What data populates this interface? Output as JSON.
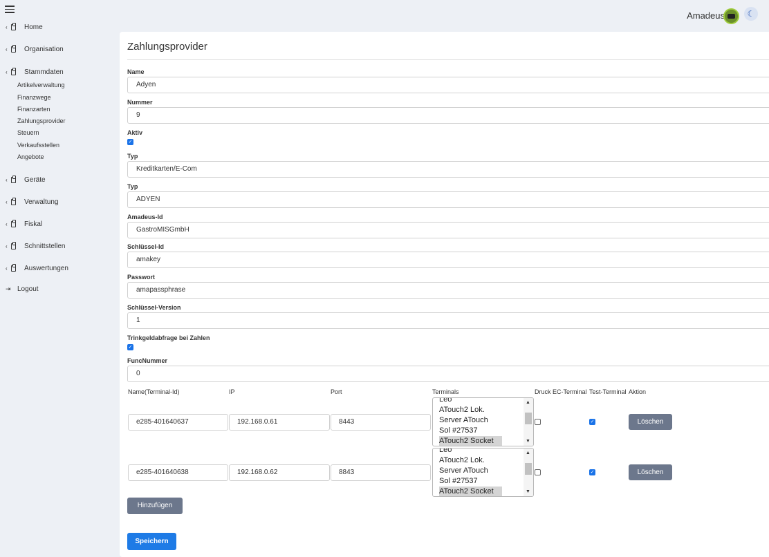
{
  "header": {
    "brand": "Amadeus",
    "brand_logo_icon": "amadeus-logo",
    "theme_icon": "moon-icon"
  },
  "sidebar": {
    "menu_icon": "hamburger-icon",
    "items": [
      {
        "label": "Home"
      },
      {
        "label": "Organisation"
      },
      {
        "label": "Stammdaten"
      },
      {
        "label": "Geräte"
      },
      {
        "label": "Verwaltung"
      },
      {
        "label": "Fiskal"
      },
      {
        "label": "Schnittstellen"
      },
      {
        "label": "Auswertungen"
      }
    ],
    "subitems": [
      {
        "label": "Artikelverwaltung"
      },
      {
        "label": "Finanzwege"
      },
      {
        "label": "Finanzarten"
      },
      {
        "label": "Zahlungsprovider"
      },
      {
        "label": "Steuern"
      },
      {
        "label": "Verkaufsstellen"
      },
      {
        "label": "Angebote"
      }
    ],
    "logout": "Logout"
  },
  "page": {
    "title": "Zahlungsprovider"
  },
  "form": {
    "name_label": "Name",
    "name_value": "Adyen",
    "nummer_label": "Nummer",
    "nummer_value": "9",
    "aktiv_label": "Aktiv",
    "aktiv_checked": true,
    "typ1_label": "Typ",
    "typ1_value": "Kreditkarten/E-Com",
    "typ2_label": "Typ",
    "typ2_value": "ADYEN",
    "amadeus_id_label": "Amadeus-Id",
    "amadeus_id_value": "GastroMISGmbH",
    "schluessel_id_label": "Schlüssel-Id",
    "schluessel_id_value": "amakey",
    "passwort_label": "Passwort",
    "passwort_value": "amapassphrase",
    "schluessel_version_label": "Schlüssel-Version",
    "schluessel_version_value": "1",
    "trinkgeld_label": "Trinkgeldabfrage bei Zahlen",
    "trinkgeld_checked": true,
    "funcnummer_label": "FuncNummer",
    "funcnummer_value": "0"
  },
  "terminals": {
    "headers": {
      "name": "Name(Terminal-Id)",
      "ip": "IP",
      "port": "Port",
      "terminals": "Terminals",
      "druck": "Druck EC-Terminal",
      "test": "Test-Terminal",
      "aktion": "Aktion"
    },
    "rows": [
      {
        "name": "e285-401640637",
        "ip": "192.168.0.61",
        "port": "8443",
        "options": [
          "Leo",
          "ATouch2 Lok.",
          "Server ATouch",
          "Sol #27537",
          "ATouch2 Socket"
        ],
        "druck": false,
        "test": true,
        "delete_label": "Löschen"
      },
      {
        "name": "e285-401640638",
        "ip": "192.168.0.62",
        "port": "8843",
        "options": [
          "Leo",
          "ATouch2 Lok.",
          "Server ATouch",
          "Sol #27537",
          "ATouch2 Socket"
        ],
        "druck": false,
        "test": true,
        "delete_label": "Löschen"
      }
    ],
    "add_label": "Hinzufügen"
  },
  "actions": {
    "save_label": "Speichern"
  }
}
